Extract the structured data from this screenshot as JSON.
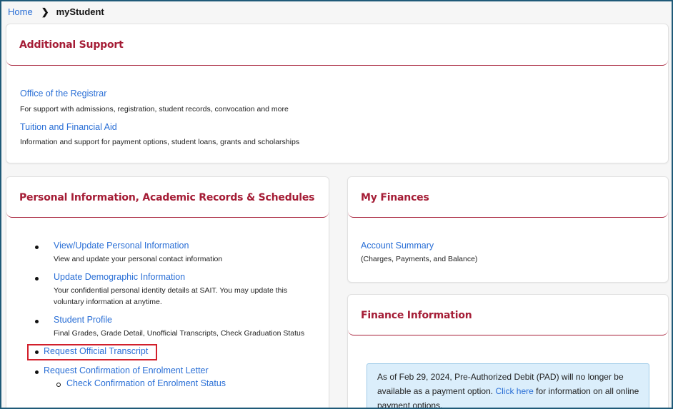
{
  "breadcrumb": {
    "home": "Home",
    "current": "myStudent"
  },
  "additional_support": {
    "title": "Additional Support",
    "links": [
      {
        "label": "Office of the Registrar",
        "description": "For support with admissions, registration, student records, convocation and more"
      },
      {
        "label": "Tuition and Financial Aid",
        "description": "Information and support for payment options, student loans, grants and scholarships"
      }
    ]
  },
  "personal_info": {
    "title": "Personal Information, Academic Records & Schedules",
    "items": [
      {
        "label": "View/Update Personal Information",
        "description": "View and update your personal contact information"
      },
      {
        "label": "Update Demographic Information",
        "description": "Your confidential personal identity details at SAIT. You may update this voluntary information at anytime."
      },
      {
        "label": "Student Profile",
        "description": "Final Grades, Grade Detail, Unofficial Transcripts, Check Graduation Status"
      },
      {
        "label": "Request Official Transcript",
        "description": ""
      },
      {
        "label": "Request Confirmation of Enrolment Letter",
        "description": ""
      }
    ],
    "sub_item": {
      "label": "Check Confirmation of Enrolment Status"
    }
  },
  "my_finances": {
    "title": "My Finances",
    "link": {
      "label": "Account Summary",
      "description": "(Charges, Payments, and Balance)"
    }
  },
  "finance_info": {
    "title": "Finance Information",
    "notice_before": "As of Feb 29, 2024, Pre-Authorized Debit (PAD) will no longer be available as a payment option.",
    "notice_link": "Click here",
    "notice_after": "for information on all online payment options."
  },
  "colors": {
    "accent": "#a51d36",
    "link": "#2a6fd6",
    "highlight": "#d21f2b",
    "notice_bg": "#dbeefb"
  }
}
